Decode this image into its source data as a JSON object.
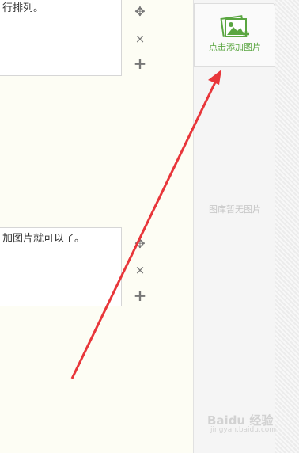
{
  "editor": {
    "block1_text": "行排列。",
    "block2_text": "加图片就可以了。",
    "controls": {
      "move": "✥",
      "remove": "×",
      "add": "+"
    }
  },
  "sidebar": {
    "add_label": "点击添加图片",
    "empty_text": "图库暂无图片"
  },
  "watermark": {
    "brand": "Baidu 经验",
    "url": "jingyan.baidu.com"
  },
  "colors": {
    "accent": "#5aa641",
    "arrow": "#e8363a"
  }
}
